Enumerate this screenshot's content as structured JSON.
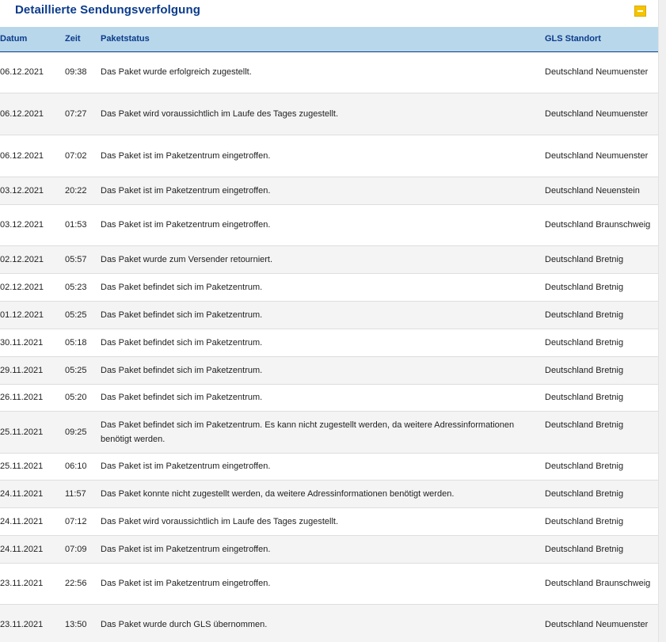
{
  "header": {
    "title": "Detaillierte Sendungsverfolgung",
    "collapse_icon": "minus-icon",
    "accent_color": "#f5c400",
    "title_color": "#0a3b8c"
  },
  "table": {
    "header_bg": "#b9d7ea",
    "columns": [
      "Datum",
      "Zeit",
      "Paketstatus",
      "GLS Standort"
    ],
    "rows": [
      {
        "date": "06.12.2021",
        "time": "09:38",
        "status": "Das Paket wurde erfolgreich zugestellt.",
        "location": "Deutschland Neumuenster"
      },
      {
        "date": "06.12.2021",
        "time": "07:27",
        "status": "Das Paket wird voraussichtlich im Laufe des Tages zugestellt.",
        "location": "Deutschland Neumuenster"
      },
      {
        "date": "06.12.2021",
        "time": "07:02",
        "status": "Das Paket ist im Paketzentrum eingetroffen.",
        "location": "Deutschland Neumuenster"
      },
      {
        "date": "03.12.2021",
        "time": "20:22",
        "status": "Das Paket ist im Paketzentrum eingetroffen.",
        "location": "Deutschland Neuenstein"
      },
      {
        "date": "03.12.2021",
        "time": "01:53",
        "status": "Das Paket ist im Paketzentrum eingetroffen.",
        "location": "Deutschland Braunschweig"
      },
      {
        "date": "02.12.2021",
        "time": "05:57",
        "status": "Das Paket wurde zum Versender retourniert.",
        "location": "Deutschland Bretnig"
      },
      {
        "date": "02.12.2021",
        "time": "05:23",
        "status": "Das Paket befindet sich im Paketzentrum.",
        "location": "Deutschland Bretnig"
      },
      {
        "date": "01.12.2021",
        "time": "05:25",
        "status": "Das Paket befindet sich im Paketzentrum.",
        "location": "Deutschland Bretnig"
      },
      {
        "date": "30.11.2021",
        "time": "05:18",
        "status": "Das Paket befindet sich im Paketzentrum.",
        "location": "Deutschland Bretnig"
      },
      {
        "date": "29.11.2021",
        "time": "05:25",
        "status": "Das Paket befindet sich im Paketzentrum.",
        "location": "Deutschland Bretnig"
      },
      {
        "date": "26.11.2021",
        "time": "05:20",
        "status": "Das Paket befindet sich im Paketzentrum.",
        "location": "Deutschland Bretnig"
      },
      {
        "date": "25.11.2021",
        "time": "09:25",
        "status": "Das Paket befindet sich im Paketzentrum. Es kann nicht zugestellt werden, da weitere Adressinformationen benötigt werden.",
        "location": "Deutschland Bretnig"
      },
      {
        "date": "25.11.2021",
        "time": "06:10",
        "status": "Das Paket ist im Paketzentrum eingetroffen.",
        "location": "Deutschland Bretnig"
      },
      {
        "date": "24.11.2021",
        "time": "11:57",
        "status": "Das Paket konnte nicht zugestellt werden, da weitere Adressinformationen benötigt werden.",
        "location": "Deutschland Bretnig"
      },
      {
        "date": "24.11.2021",
        "time": "07:12",
        "status": "Das Paket wird voraussichtlich im Laufe des Tages zugestellt.",
        "location": "Deutschland Bretnig"
      },
      {
        "date": "24.11.2021",
        "time": "07:09",
        "status": "Das Paket ist im Paketzentrum eingetroffen.",
        "location": "Deutschland Bretnig"
      },
      {
        "date": "23.11.2021",
        "time": "22:56",
        "status": "Das Paket ist im Paketzentrum eingetroffen.",
        "location": "Deutschland Braunschweig"
      },
      {
        "date": "23.11.2021",
        "time": "13:50",
        "status": "Das Paket wurde durch GLS übernommen.",
        "location": "Deutschland Neumuenster"
      }
    ]
  }
}
